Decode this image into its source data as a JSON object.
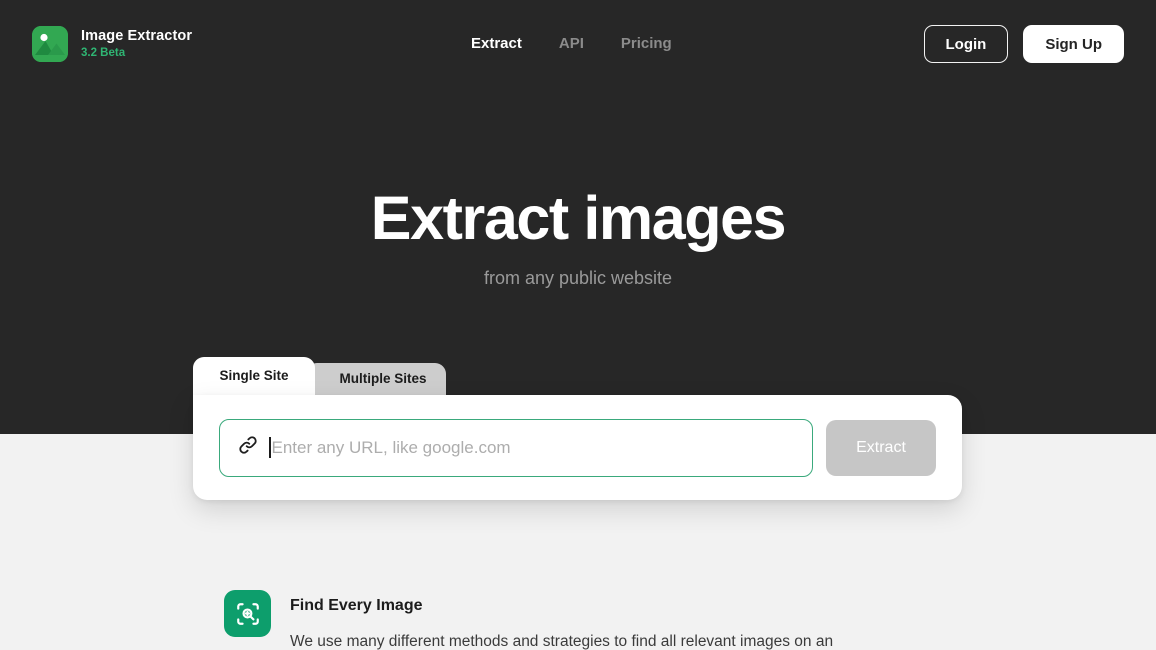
{
  "colors": {
    "hero_bg": "#272727",
    "page_bg": "#f2f2f2",
    "accent_green": "#2fb573",
    "input_border_green": "#3aa97c",
    "logo_green": "#32a852",
    "feature_icon_green": "#0d9e6c",
    "disabled_gray": "#c6c6c6",
    "inactive_tab_gray": "#cdcdcd"
  },
  "navbar": {
    "logo_icon": "image-mountain-icon",
    "brand_name": "Image Extractor",
    "version": "3.2 Beta",
    "links": [
      {
        "label": "Extract",
        "active": true
      },
      {
        "label": "API",
        "active": false
      },
      {
        "label": "Pricing",
        "active": false
      }
    ],
    "login_label": "Login",
    "signup_label": "Sign Up"
  },
  "hero": {
    "title": "Extract images",
    "subtitle": "from any public website"
  },
  "extractor": {
    "tabs": [
      {
        "label": "Single Site",
        "active": true
      },
      {
        "label": "Multiple Sites",
        "active": false
      }
    ],
    "url_input": {
      "icon": "link-icon",
      "value": "",
      "placeholder": "Enter any URL, like google.com",
      "focused": true
    },
    "extract_button": {
      "label": "Extract",
      "disabled": true
    }
  },
  "feature": {
    "icon": "scan-search-icon",
    "title": "Find Every Image",
    "text": "We use many different methods and strategies to find all relevant images on an"
  }
}
